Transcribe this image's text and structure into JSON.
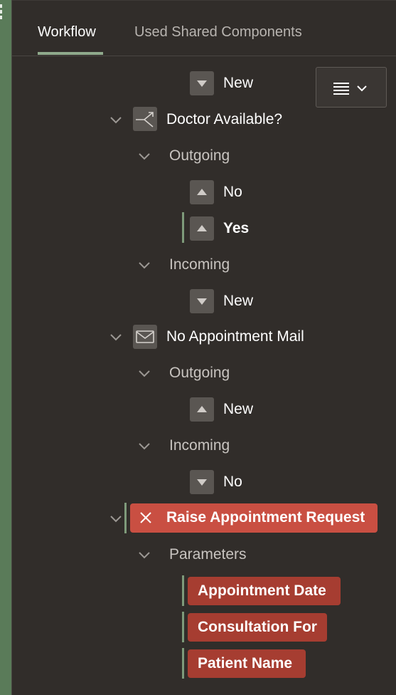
{
  "tabs": [
    {
      "label": "Workflow",
      "active": true
    },
    {
      "label": "Used Shared Components",
      "active": false
    }
  ],
  "icons": {
    "menu": "hamburger-menu-icon",
    "chevron": "chevron-down-icon",
    "switch": "switch-branch-icon",
    "mail": "mail-icon",
    "close": "close-x-icon",
    "arrow_down": "triangle-down-icon",
    "arrow_up": "triangle-up-icon"
  },
  "tree": {
    "top_new": "New",
    "doctor_available": {
      "label": "Doctor Available?",
      "outgoing": "Outgoing",
      "out_no": "No",
      "out_yes": "Yes",
      "incoming": "Incoming",
      "in_new": "New"
    },
    "no_appointment_mail": {
      "label": "No Appointment Mail",
      "outgoing": "Outgoing",
      "out_new": "New",
      "incoming": "Incoming",
      "in_no": "No"
    },
    "raise_request": {
      "label": "Raise Appointment Request",
      "parameters": "Parameters",
      "params": [
        "Appointment Date",
        "Consultation For",
        "Patient Name"
      ]
    }
  },
  "colors": {
    "panel_bg": "#312d2a",
    "left_strip": "#5a7b59",
    "activity_error": "#c94f42",
    "param_error": "#a63d31",
    "selection": "#7e9a7a"
  }
}
